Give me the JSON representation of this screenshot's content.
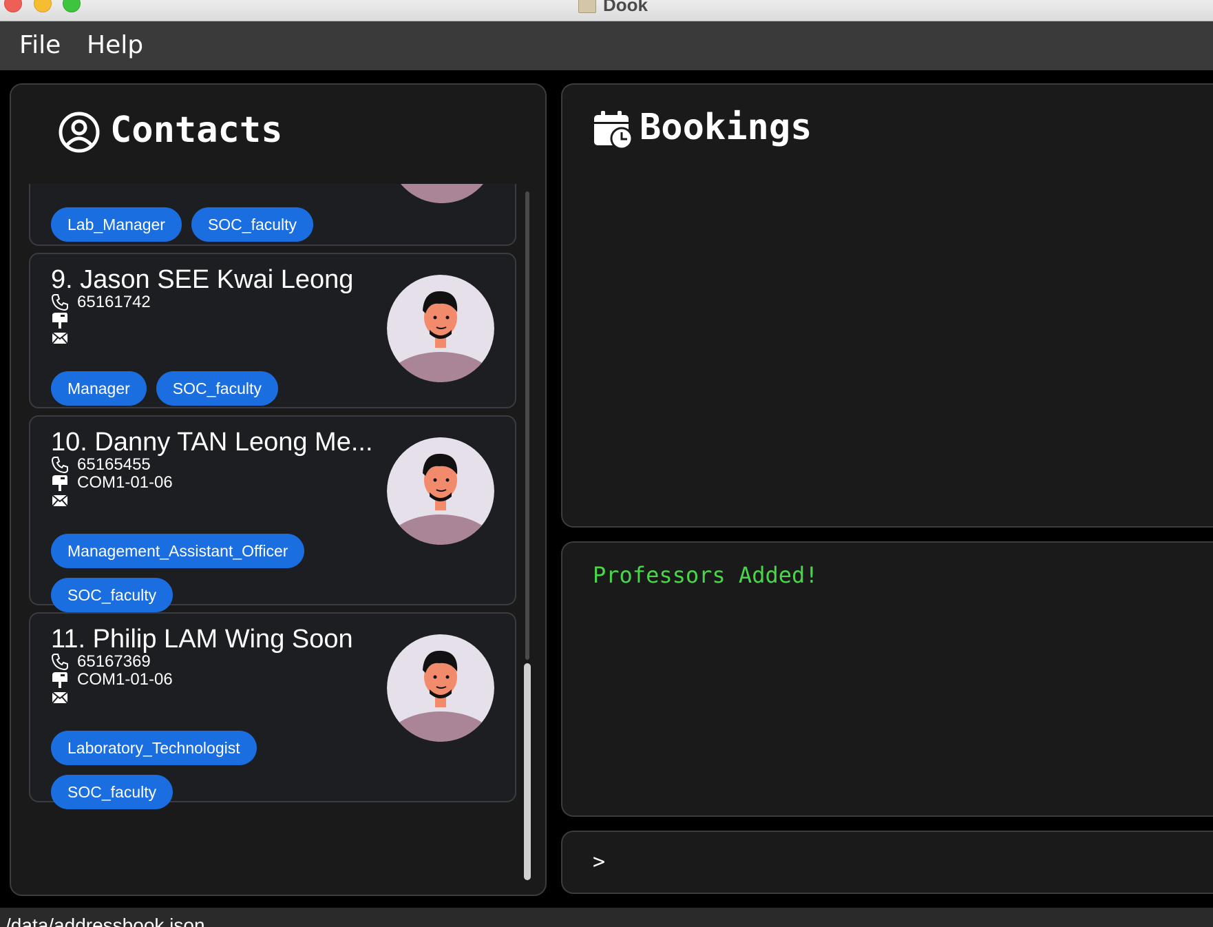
{
  "window": {
    "title": "Dook"
  },
  "menu": {
    "file": "File",
    "help": "Help"
  },
  "contacts": {
    "title": "Contacts",
    "partial_card": {
      "tags": [
        "Lab_Manager",
        "SOC_faculty"
      ]
    },
    "cards": [
      {
        "name": "9. Jason SEE Kwai Leong",
        "phone": "65161742",
        "address": "",
        "email": "",
        "tags": [
          "Manager",
          "SOC_faculty"
        ]
      },
      {
        "name": "10. Danny TAN Leong Me...",
        "phone": "65165455",
        "address": "COM1-01-06",
        "email": "",
        "tags": [
          "Management_Assistant_Officer",
          "SOC_faculty"
        ]
      },
      {
        "name": "11. Philip LAM Wing Soon",
        "phone": "65167369",
        "address": "COM1-01-06",
        "email": "",
        "tags": [
          "Laboratory_Technologist",
          "SOC_faculty"
        ]
      }
    ]
  },
  "bookings": {
    "title": "Bookings"
  },
  "result": {
    "message": "Professors Added!"
  },
  "command": {
    "prompt": ">",
    "value": ""
  },
  "status": {
    "path": "/data/addressbook.json"
  },
  "colors": {
    "tag": "#1a6ee0",
    "result_text": "#4ad64a",
    "panel": "#1a1a1a",
    "card": "#1d1e22"
  }
}
